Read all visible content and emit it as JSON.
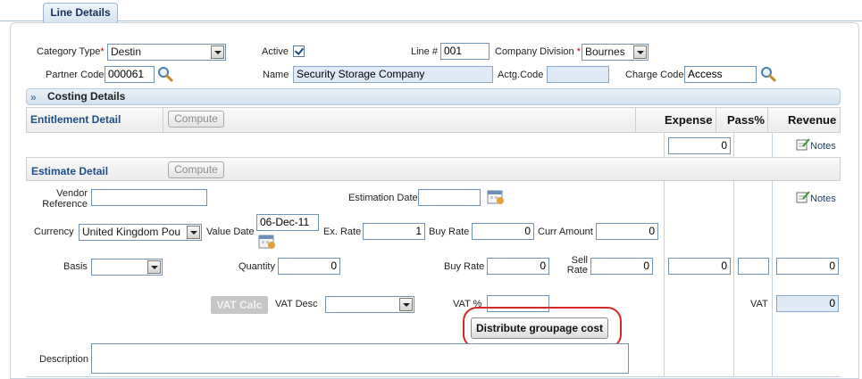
{
  "tab": {
    "label": "Line Details"
  },
  "header": {
    "category_type": {
      "label": "Category Type",
      "req": "*",
      "value": "Destin"
    },
    "active": {
      "label": "Active",
      "checked": true
    },
    "line_no": {
      "label": "Line #",
      "value": "001"
    },
    "company_division": {
      "label": "Company Division",
      "req": "*",
      "value": "Bournes"
    },
    "partner_code": {
      "label": "Partner Code",
      "value": "000061"
    },
    "name": {
      "label": "Name",
      "value": "Security Storage Company"
    },
    "actg_code": {
      "label": "Actg.Code",
      "value": ""
    },
    "charge_code": {
      "label": "Charge Code",
      "value": "Access"
    }
  },
  "costing": {
    "title": "Costing Details"
  },
  "entitlement": {
    "title": "Entitlement Detail",
    "compute_label": "Compute",
    "col_expense": "Expense",
    "col_pass": "Pass%",
    "col_revenue": "Revenue",
    "expense_value": "0",
    "notes_label": "Notes"
  },
  "estimate": {
    "title": "Estimate Detail",
    "compute_label": "Compute",
    "vendor_reference_label": "Vendor Reference",
    "vendor_reference_value": "",
    "estimation_date_label": "Estimation Date",
    "estimation_date_value": "",
    "notes_label": "Notes",
    "currency_label": "Currency",
    "currency_value": "United Kingdom Pou",
    "value_date_label": "Value Date",
    "value_date_value": "06-Dec-11",
    "ex_rate_label": "Ex. Rate",
    "ex_rate_value": "1",
    "buy_rate_label": "Buy Rate",
    "buy_rate_value": "0",
    "curr_amount_label": "Curr Amount",
    "curr_amount_value": "0",
    "basis_label": "Basis",
    "basis_value": "",
    "quantity_label": "Quantity",
    "quantity_value": "0",
    "buy_rate2_label": "Buy Rate",
    "buy_rate2_value": "0",
    "sell_rate_label": "Sell Rate",
    "sell_rate_value": "0",
    "expense_value": "0",
    "pass_value": "",
    "revenue_value": "0",
    "vat_calc_label": "VAT Calc",
    "vat_desc_label": "VAT Desc",
    "vat_desc_value": "",
    "vat_pct_label": "VAT %",
    "vat_pct_value": "",
    "vat_label": "VAT",
    "vat_value": "0",
    "distribute_label": "Distribute groupage cost",
    "description_label": "Description",
    "description_value": ""
  }
}
